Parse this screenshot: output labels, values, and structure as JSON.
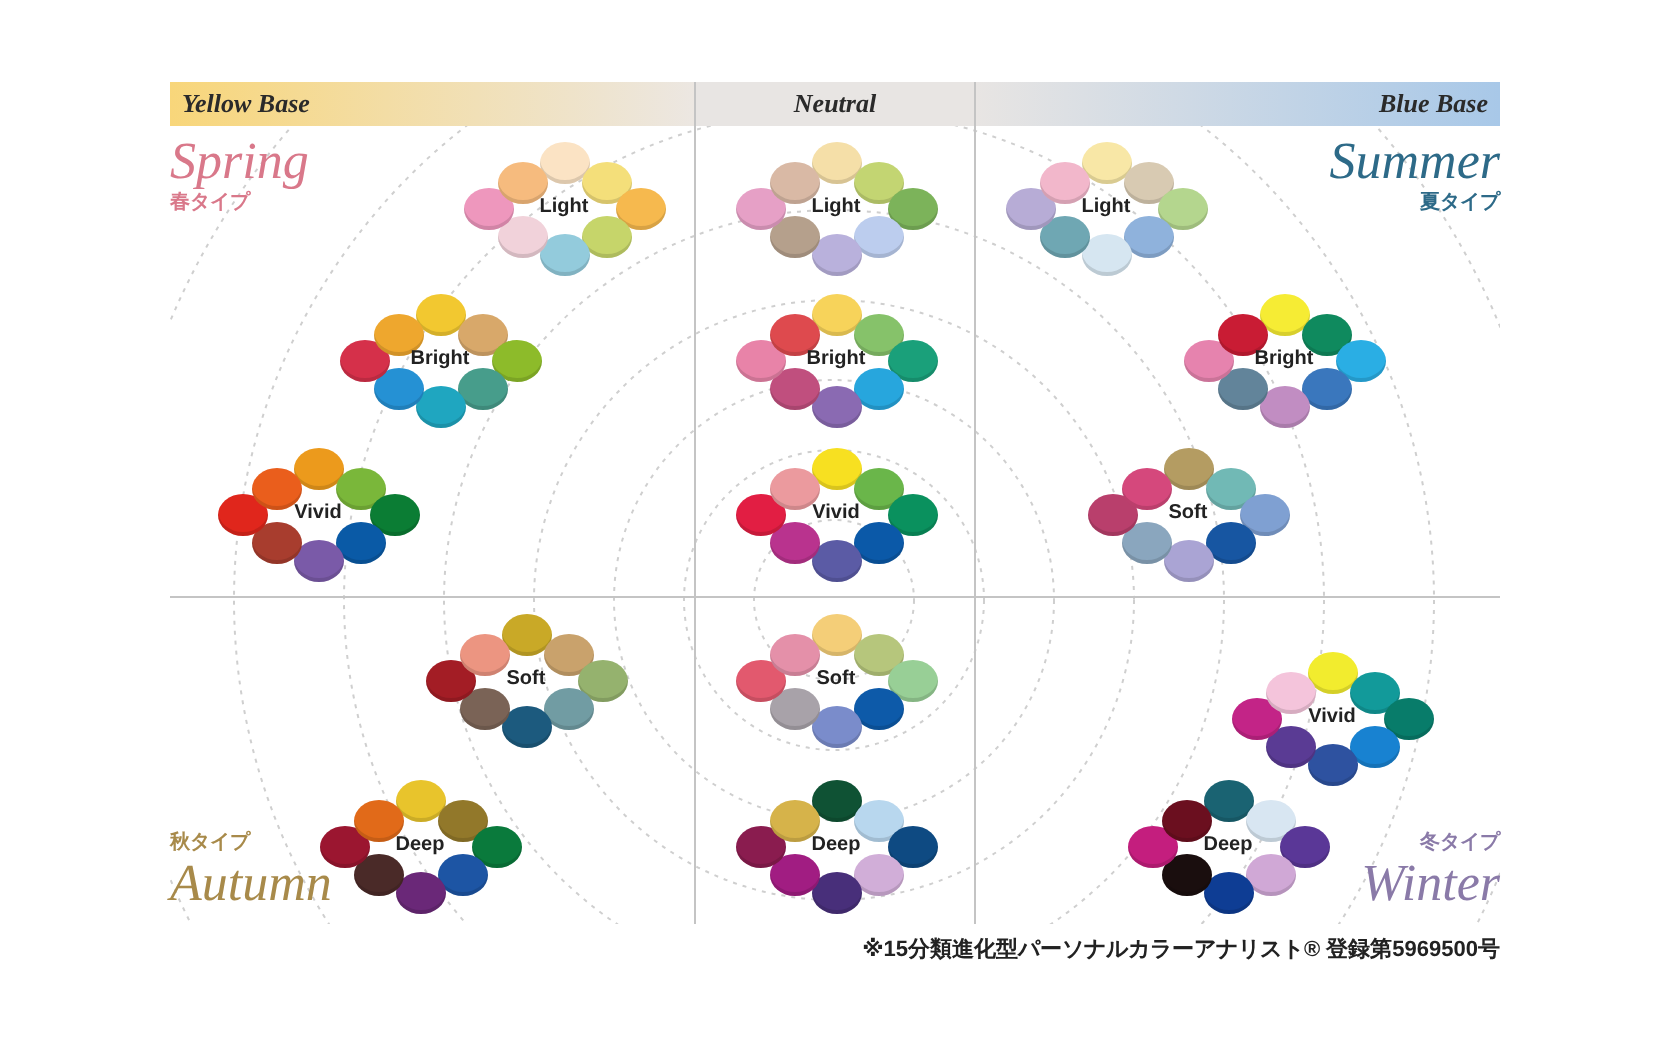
{
  "header": [
    {
      "label": "Yellow Base"
    },
    {
      "label": "Neutral"
    },
    {
      "label": "Blue Base"
    }
  ],
  "rows": [
    {
      "cells": [
        {
          "season": {
            "name": "Spring",
            "subtitle": "春タイプ",
            "color": "#d9788a"
          },
          "groups": [
            {
              "label": "Light",
              "swatches": [
                {
                  "color": "#fbe3c4"
                },
                {
                  "color": "#f4df7a"
                },
                {
                  "color": "#f6b94e"
                },
                {
                  "color": "#c6d56a"
                },
                {
                  "color": "#93cbdc"
                },
                {
                  "color": "#f1d2da"
                },
                {
                  "color": "#ee97bd"
                },
                {
                  "color": "#f6bb7e"
                }
              ]
            },
            {
              "label": "Bright",
              "swatches": [
                {
                  "color": "#f2c830"
                },
                {
                  "color": "#d8a86a"
                },
                {
                  "color": "#8dbb2a"
                },
                {
                  "color": "#479d8b"
                },
                {
                  "color": "#1fa6c0"
                },
                {
                  "color": "#2591d4"
                },
                {
                  "color": "#d5304a"
                },
                {
                  "color": "#eea72e"
                }
              ]
            },
            {
              "label": "Vivid",
              "swatches": [
                {
                  "color": "#ec9a1c"
                },
                {
                  "color": "#7ab73a"
                },
                {
                  "color": "#0b7d34"
                },
                {
                  "color": "#0a5aa6"
                },
                {
                  "color": "#7a5aa8"
                },
                {
                  "color": "#a83d2e"
                },
                {
                  "color": "#e0261c"
                },
                {
                  "color": "#ea5e1c"
                }
              ]
            }
          ]
        },
        {
          "groups": [
            {
              "label": "Light",
              "swatches": [
                {
                  "color": "#f5dfa8"
                },
                {
                  "color": "#c3d572"
                },
                {
                  "color": "#7cb35a"
                },
                {
                  "color": "#bccdee"
                },
                {
                  "color": "#b9b1dc"
                },
                {
                  "color": "#b5a08c"
                },
                {
                  "color": "#e6a0c6"
                },
                {
                  "color": "#d9b9a5"
                }
              ]
            },
            {
              "label": "Bright",
              "swatches": [
                {
                  "color": "#f7d35a"
                },
                {
                  "color": "#86c26a"
                },
                {
                  "color": "#1aa07a"
                },
                {
                  "color": "#27a6dd"
                },
                {
                  "color": "#8a6ab2"
                },
                {
                  "color": "#c04f7e"
                },
                {
                  "color": "#e883a8"
                },
                {
                  "color": "#de4a4e"
                }
              ]
            },
            {
              "label": "Vivid",
              "swatches": [
                {
                  "color": "#f7e021"
                },
                {
                  "color": "#6ab64a"
                },
                {
                  "color": "#0a915e"
                },
                {
                  "color": "#0b59a8"
                },
                {
                  "color": "#5b5ba5"
                },
                {
                  "color": "#b9338e"
                },
                {
                  "color": "#e21e43"
                },
                {
                  "color": "#eb9a9e"
                }
              ]
            }
          ]
        },
        {
          "season": {
            "name": "Summer",
            "subtitle": "夏タイプ",
            "color": "#2d6a88"
          },
          "groups": [
            {
              "label": "Light",
              "swatches": [
                {
                  "color": "#f8e7a6"
                },
                {
                  "color": "#d8cab2"
                },
                {
                  "color": "#b4d68e"
                },
                {
                  "color": "#8fb2dc"
                },
                {
                  "color": "#d6e6f1"
                },
                {
                  "color": "#6fa7b3"
                },
                {
                  "color": "#b7acd6"
                },
                {
                  "color": "#f2b7cb"
                }
              ]
            },
            {
              "label": "Bright",
              "swatches": [
                {
                  "color": "#f6ec34"
                },
                {
                  "color": "#0f8a5e"
                },
                {
                  "color": "#2aaee4"
                },
                {
                  "color": "#3a77bd"
                },
                {
                  "color": "#c18dc2"
                },
                {
                  "color": "#62849a"
                },
                {
                  "color": "#e683ae"
                },
                {
                  "color": "#c91c34"
                }
              ]
            },
            {
              "label": "Soft",
              "swatches": [
                {
                  "color": "#b49c62"
                },
                {
                  "color": "#71b9b5"
                },
                {
                  "color": "#7fa0d2"
                },
                {
                  "color": "#1756a2"
                },
                {
                  "color": "#aaa4d4"
                },
                {
                  "color": "#8aa6be"
                },
                {
                  "color": "#b93f6c"
                },
                {
                  "color": "#d5487c"
                }
              ]
            }
          ]
        }
      ]
    },
    {
      "cells": [
        {
          "season": {
            "name": "Autumn",
            "subtitle": "秋タイプ",
            "color": "#a88a4a"
          },
          "groups": [
            {
              "label": "Soft",
              "swatches": [
                {
                  "color": "#c9a927"
                },
                {
                  "color": "#c9a26c"
                },
                {
                  "color": "#95b26e"
                },
                {
                  "color": "#719ca3"
                },
                {
                  "color": "#1c5a7e"
                },
                {
                  "color": "#7a6356"
                },
                {
                  "color": "#a31d25"
                },
                {
                  "color": "#ec9581"
                }
              ]
            },
            {
              "label": "Deep",
              "swatches": [
                {
                  "color": "#e8c42c"
                },
                {
                  "color": "#92782a"
                },
                {
                  "color": "#0a7a3c"
                },
                {
                  "color": "#1d55a4"
                },
                {
                  "color": "#6a2878"
                },
                {
                  "color": "#4a2a28"
                },
                {
                  "color": "#9b1630"
                },
                {
                  "color": "#e16a19"
                }
              ]
            }
          ]
        },
        {
          "groups": [
            {
              "label": "Soft",
              "swatches": [
                {
                  "color": "#f4ce78"
                },
                {
                  "color": "#b6c67c"
                },
                {
                  "color": "#98cf96"
                },
                {
                  "color": "#0d5aa9"
                },
                {
                  "color": "#7a8ccb"
                },
                {
                  "color": "#a8a2a9"
                },
                {
                  "color": "#e2596e"
                },
                {
                  "color": "#e490a9"
                }
              ]
            },
            {
              "label": "Deep",
              "swatches": [
                {
                  "color": "#0f5234"
                },
                {
                  "color": "#b8d7ee"
                },
                {
                  "color": "#0e4a82"
                },
                {
                  "color": "#d1aed8"
                },
                {
                  "color": "#482f7a"
                },
                {
                  "color": "#a11d82"
                },
                {
                  "color": "#8a1c4f"
                },
                {
                  "color": "#d6b34a"
                }
              ]
            }
          ]
        },
        {
          "season": {
            "name": "Winter",
            "subtitle": "冬タイプ",
            "color": "#8a7aa8"
          },
          "groups": [
            {
              "label": "Vivid",
              "swatches": [
                {
                  "color": "#f2ec2e"
                },
                {
                  "color": "#129a9a"
                },
                {
                  "color": "#087c6a"
                },
                {
                  "color": "#1882d1"
                },
                {
                  "color": "#2e52a0"
                },
                {
                  "color": "#5a3b94"
                },
                {
                  "color": "#c32487"
                },
                {
                  "color": "#f4c4db"
                }
              ]
            },
            {
              "label": "Deep",
              "swatches": [
                {
                  "color": "#1a6372"
                },
                {
                  "color": "#d8e6f2"
                },
                {
                  "color": "#5a3797"
                },
                {
                  "color": "#d0a8d6"
                },
                {
                  "color": "#0e3d94"
                },
                {
                  "color": "#1a0e0e"
                },
                {
                  "color": "#c41e7e"
                },
                {
                  "color": "#6b0f1f"
                }
              ]
            }
          ]
        }
      ]
    }
  ],
  "footnote": "※15分類進化型パーソナルカラーアナリスト® 登録第5969500号"
}
